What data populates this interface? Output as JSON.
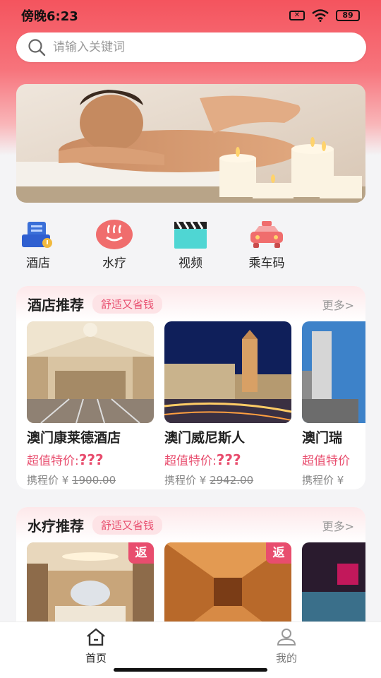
{
  "status_bar": {
    "time": "傍晚6:23",
    "battery": "89"
  },
  "search": {
    "placeholder": "请输入关键词"
  },
  "quick_menu": [
    {
      "label": "酒店",
      "icon": "hotel-icon"
    },
    {
      "label": "水疗",
      "icon": "spa-icon"
    },
    {
      "label": "视频",
      "icon": "clapperboard-icon"
    },
    {
      "label": "乘车码",
      "icon": "car-icon"
    }
  ],
  "hotel_section": {
    "title": "酒店推荐",
    "tag": "舒适又省钱",
    "more": "更多>",
    "cards": [
      {
        "name": "澳门康莱德酒店",
        "price_label": "超值特价:",
        "price": "???",
        "orig_label": "携程价 ¥",
        "orig_price": "1900.00"
      },
      {
        "name": "澳门威尼斯人",
        "price_label": "超值特价:",
        "price": "???",
        "orig_label": "携程价 ¥",
        "orig_price": "2942.00"
      },
      {
        "name": "澳门瑞",
        "price_label": "超值特价",
        "price": "",
        "orig_label": "携程价 ¥",
        "orig_price": ""
      }
    ]
  },
  "spa_section": {
    "title": "水疗推荐",
    "tag": "舒适又省钱",
    "more": "更多>",
    "rebate": "返"
  },
  "bottom_nav": [
    {
      "label": "首页",
      "icon": "home-icon",
      "active": true
    },
    {
      "label": "我的",
      "icon": "user-icon",
      "active": false
    }
  ],
  "colors": {
    "accent": "#e84d6e",
    "header": "#f4545e"
  }
}
